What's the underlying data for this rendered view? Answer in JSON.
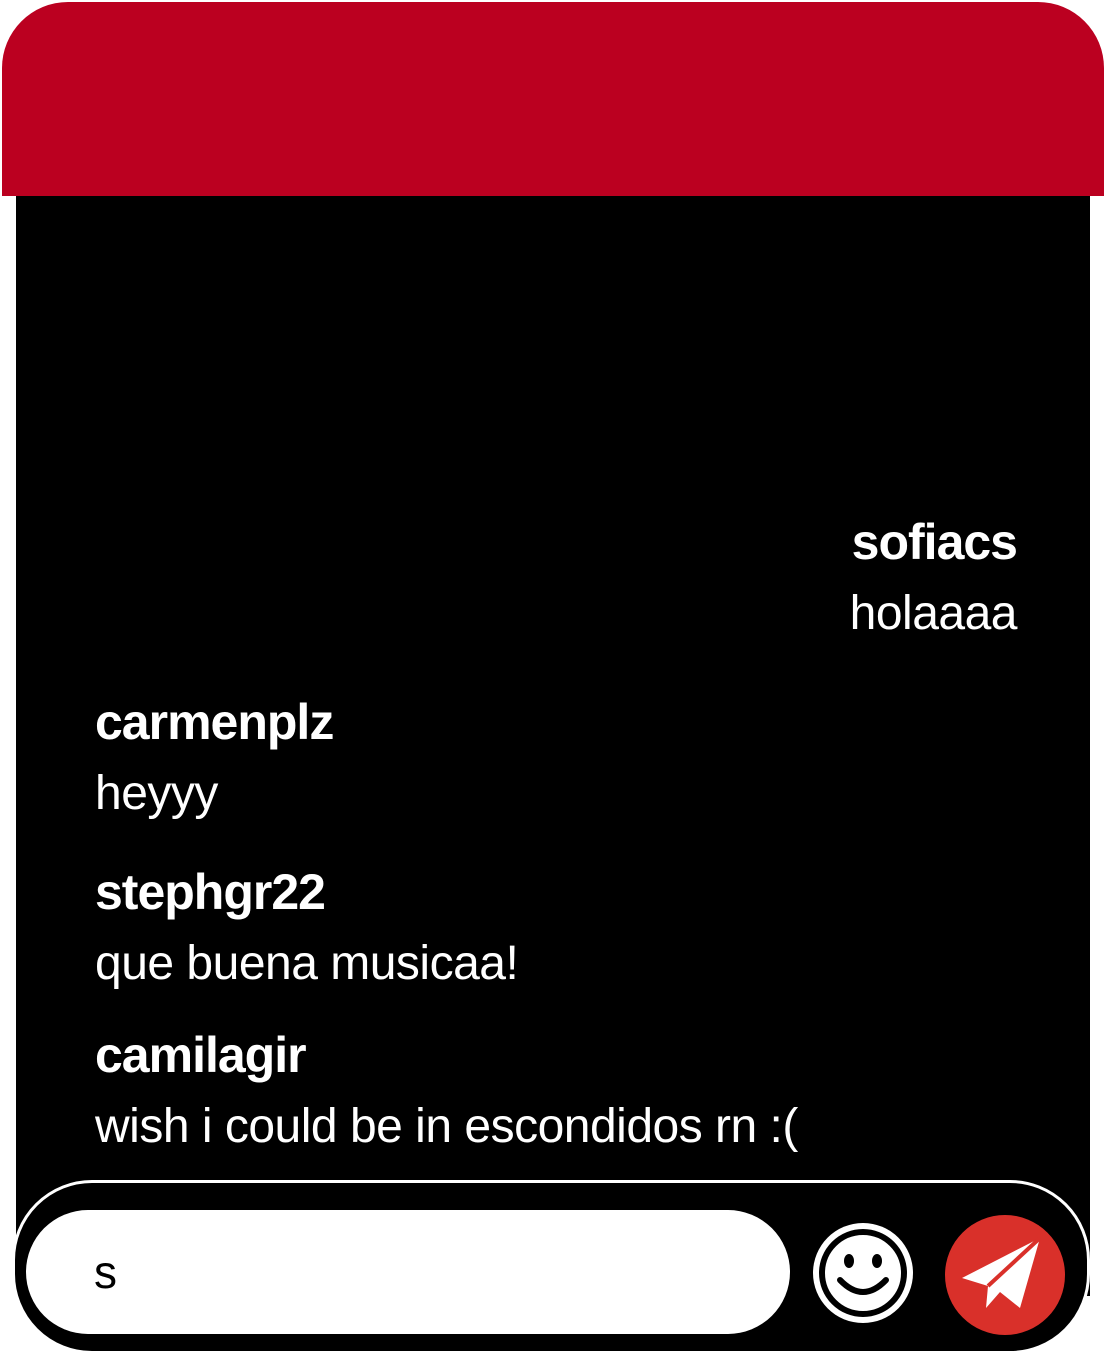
{
  "header": {
    "color": "#bb0020"
  },
  "messages": [
    {
      "user": "sofiacs",
      "text": "holaaaa",
      "align": "right"
    },
    {
      "user": "carmenplz",
      "text": "heyyy",
      "align": "left"
    },
    {
      "user": "stephgr22",
      "text": "que buena musicaa!",
      "align": "left"
    },
    {
      "user": "camilagir",
      "text": "wish i could be in escondidos rn :(",
      "align": "left"
    }
  ],
  "composer": {
    "value": "s",
    "emoji_icon": "smiley-face-icon",
    "send_icon": "paper-plane-icon",
    "send_color": "#d9302a"
  }
}
